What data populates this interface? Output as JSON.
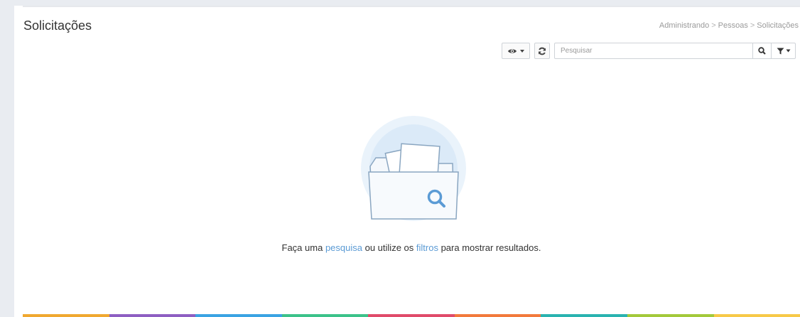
{
  "page": {
    "title": "Solicitações",
    "breadcrumb": [
      "Administrando",
      "Pessoas",
      "Solicitações"
    ],
    "breadcrumb_separator": ">"
  },
  "toolbar": {
    "view_icon": "eye-icon",
    "refresh_icon": "refresh-icon",
    "search_placeholder": "Pesquisar",
    "search_icon": "search-icon",
    "filter_icon": "filter-icon"
  },
  "empty_state": {
    "text_1": "Faça uma",
    "link_search": "pesquisa",
    "text_2": "ou utilize os",
    "link_filters": "filtros",
    "text_3": "para mostrar resultados.",
    "illustration": "empty-folder-search-icon"
  },
  "colors": {
    "link": "#5b9bd5",
    "text": "#333333",
    "muted": "#9a9a9a",
    "bottom_bar": [
      "#f0a830",
      "#8e5fc2",
      "#3aa3e3",
      "#3cc28a",
      "#e04b6a",
      "#f27a3c",
      "#2ab3b0",
      "#a3c93a",
      "#f7c948"
    ]
  }
}
